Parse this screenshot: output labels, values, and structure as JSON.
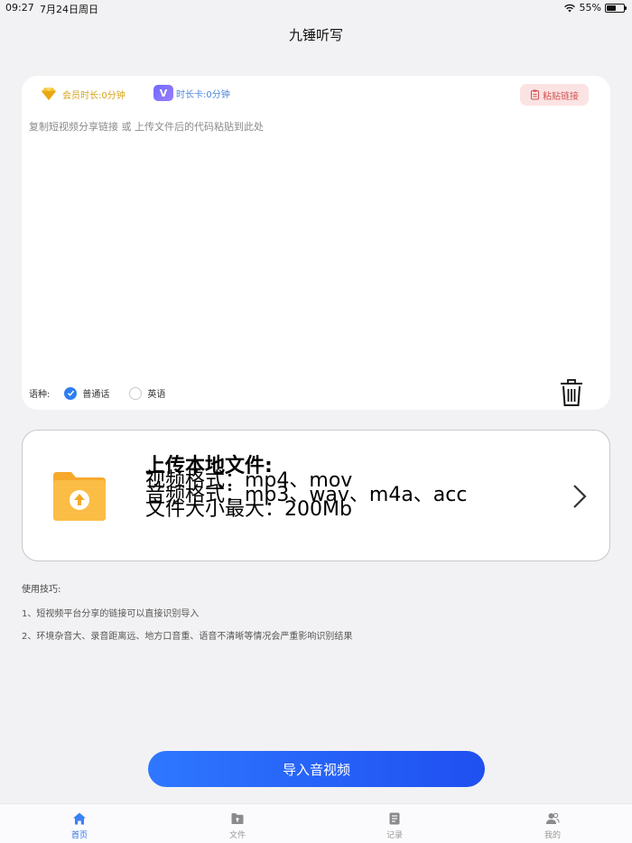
{
  "status": {
    "time": "09:27",
    "date": "7月24日周日",
    "battery_percent": "55%",
    "battery_level": 0.55
  },
  "header": {
    "title": "九锤听写"
  },
  "input_card": {
    "member_label": "会员时长:0分钟",
    "card_badge": "V",
    "card_label": "时长卡:0分钟",
    "paste_label": "粘贴链接",
    "placeholder": "复制短视频分享链接 或 上传文件后的代码粘贴到此处",
    "language_label": "语种:",
    "languages": [
      {
        "label": "普通话",
        "selected": true
      },
      {
        "label": "英语",
        "selected": false
      }
    ]
  },
  "upload_card": {
    "title": "上传本地文件:",
    "video_formats": "视频格式：mp4、mov",
    "audio_formats": "音频格式：mp3、wav、m4a、acc",
    "size_limit": "文件大小最大：200Mb"
  },
  "tips": {
    "title": "使用技巧:",
    "items": [
      "1、短视频平台分享的链接可以直接识别导入",
      "2、环境杂音大、录音距离远、地方口音重、语音不清晰等情况会严重影响识别结果"
    ]
  },
  "import_button": "导入音视频",
  "tab_bar": {
    "tabs": [
      {
        "label": "首页",
        "icon": "home-icon",
        "active": true
      },
      {
        "label": "文件",
        "icon": "file-icon",
        "active": false
      },
      {
        "label": "记录",
        "icon": "record-icon",
        "active": false
      },
      {
        "label": "我的",
        "icon": "profile-icon",
        "active": false
      }
    ]
  },
  "colors": {
    "accent": "#2f7ff0",
    "button_start": "#2e77ff",
    "button_end": "#1f4ff0",
    "member_gold": "#d4a319",
    "card_blue": "#4a86d8",
    "paste_red": "#d25454"
  }
}
